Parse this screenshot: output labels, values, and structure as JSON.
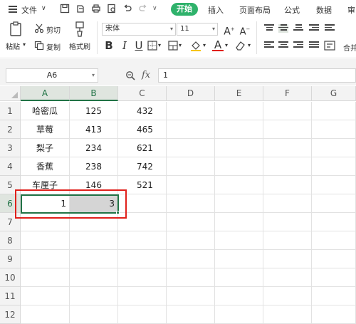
{
  "menubar": {
    "file_menu": "文件",
    "tabs": [
      "开始",
      "插入",
      "页面布局",
      "公式",
      "数据",
      "审"
    ],
    "active_tab": "开始"
  },
  "ribbon": {
    "paste_label": "粘贴",
    "cut_label": "剪切",
    "copy_label": "复制",
    "format_painter_label": "格式刷",
    "font_name": "宋体",
    "font_size": "11",
    "merge_label": "合并"
  },
  "formula_bar": {
    "name_box": "A6",
    "fx_label": "fx",
    "value": "1"
  },
  "sheet": {
    "columns": [
      "A",
      "B",
      "C",
      "D",
      "E",
      "F",
      "G"
    ],
    "selected_columns": [
      "A",
      "B"
    ],
    "rows": [
      "1",
      "2",
      "3",
      "4",
      "5",
      "6",
      "7",
      "8",
      "9",
      "10",
      "11",
      "12"
    ],
    "selected_row": "6",
    "data": [
      {
        "fruit": "哈密瓜",
        "b": "125",
        "c": "432"
      },
      {
        "fruit": "草莓",
        "b": "413",
        "c": "465"
      },
      {
        "fruit": "梨子",
        "b": "234",
        "c": "621"
      },
      {
        "fruit": "香蕉",
        "b": "238",
        "c": "742"
      },
      {
        "fruit": "车厘子",
        "b": "146",
        "c": "521"
      },
      {
        "fruit": "1",
        "b": "3",
        "c": ""
      }
    ]
  },
  "colors": {
    "accent": "#2fb26b",
    "selection": "#217346",
    "highlight_box": "#e0201b"
  }
}
